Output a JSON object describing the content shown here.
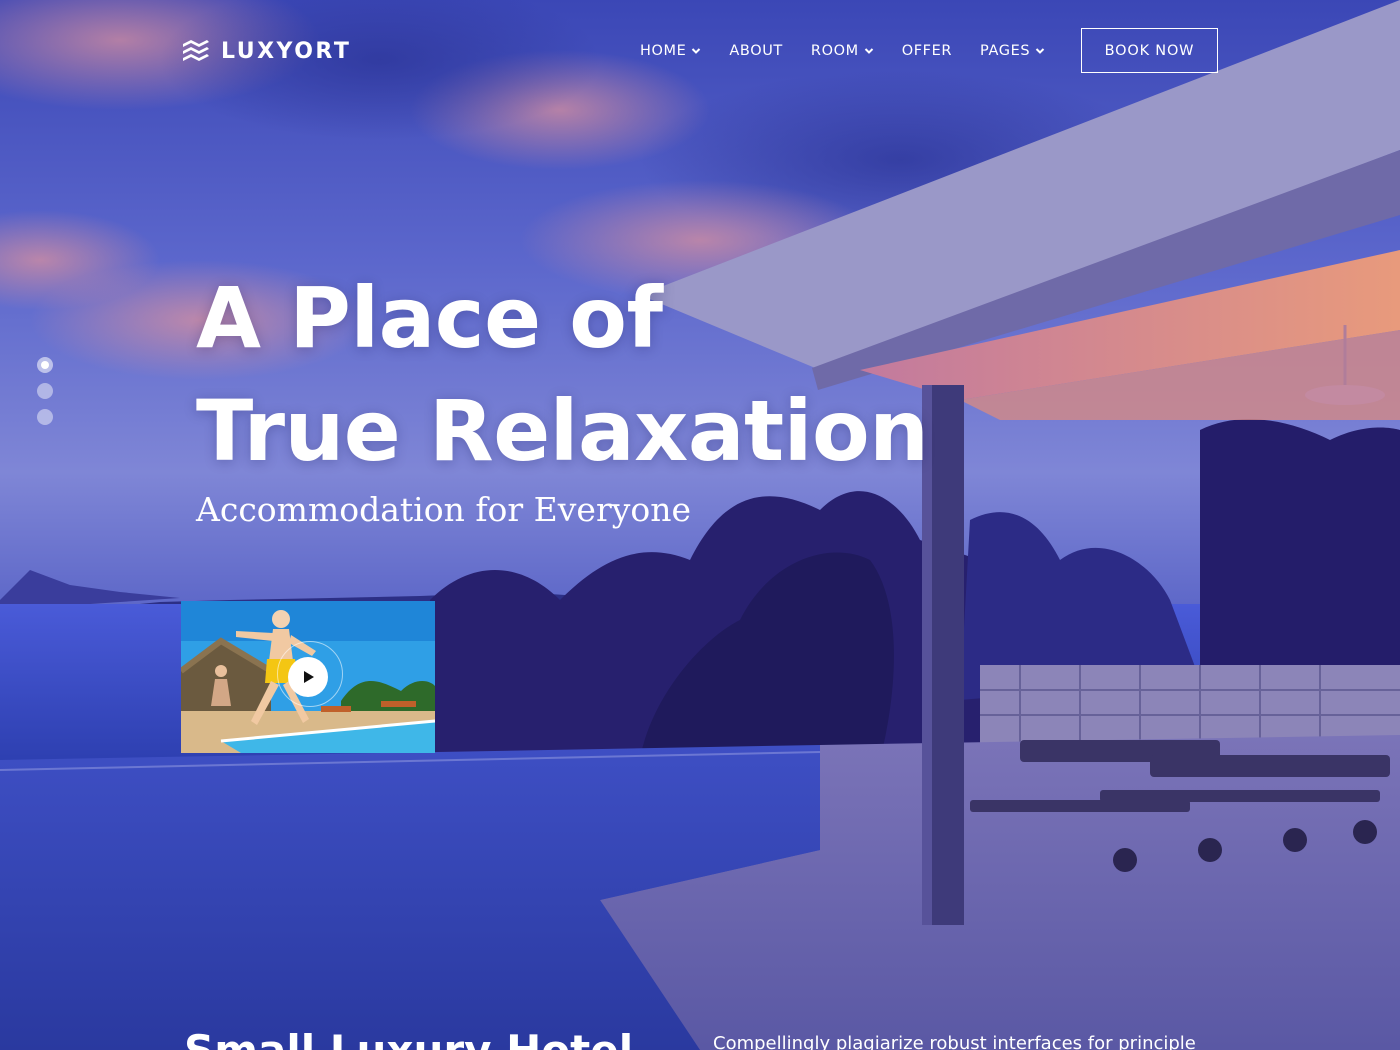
{
  "brand": {
    "name": "LUXYORT",
    "logo_icon": "wave-stack-icon"
  },
  "nav": {
    "items": [
      {
        "label": "HOME",
        "has_dropdown": true
      },
      {
        "label": "ABOUT",
        "has_dropdown": false
      },
      {
        "label": "ROOM",
        "has_dropdown": true
      },
      {
        "label": "OFFER",
        "has_dropdown": false
      },
      {
        "label": "PAGES",
        "has_dropdown": true
      }
    ],
    "cta_label": "BOOK NOW"
  },
  "slider": {
    "total": 3,
    "active_index": 0
  },
  "hero": {
    "headline_line1": "A Place of",
    "headline_line2": "True Relaxation",
    "subheadline": "Accommodation for Everyone",
    "video_icon": "play-icon"
  },
  "next_section": {
    "title_partial": "Small Luxury Hotel",
    "text_partial": "Compellingly plagiarize robust interfaces for principle"
  },
  "colors": {
    "overlay": "#3a45b8",
    "text": "#ffffff"
  }
}
